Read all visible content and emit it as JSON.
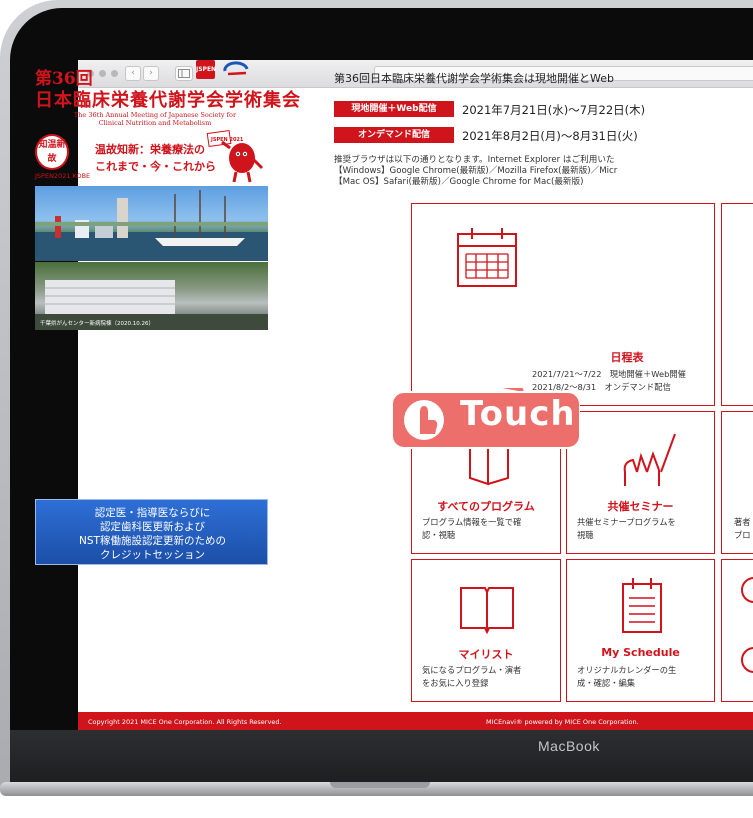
{
  "device": {
    "label": "MacBook"
  },
  "browser": {
    "back": "‹",
    "forward": "›"
  },
  "left": {
    "title_line1": "第36回",
    "title_line2": "日本臨床栄養代謝学会学術集会",
    "english_line1": "The 36th Annual Meeting of Japanese Society for",
    "english_line2": "Clinical Nutrition and Metabolism",
    "logo_badge": "JSPEN",
    "emblem_text": "知温新故",
    "emblem_sub": "JSPEN2021 KOBE",
    "theme_line1": "温故知新：栄養療法の",
    "theme_line2": "これまで・今・これから",
    "mascot_badge": "JSPEN 2021",
    "photo2_caption": "千葉県がんセンター新病院棟（2020.10.26）",
    "credit_lines": [
      "認定医・指導医ならびに",
      "認定歯科医更新および",
      "NST稼働施設認定更新のための",
      "クレジットセッション"
    ]
  },
  "right": {
    "headline": "第36回日本臨床栄養代謝学会学術集会は現地開催とWeb",
    "schedule": [
      {
        "tag": "現地開催＋Web配信",
        "date": "2021年7月21日(水)〜7月22日(木)"
      },
      {
        "tag": "オンデマンド配信",
        "date": "2021年8月2日(月)〜8月31日(火)"
      }
    ],
    "notes": [
      "推奨ブラウザは以下の通りとなります。Internet Explorer はご利用いた",
      "【Windows】Google Chrome(最新版)／Mozilla Firefox(最新版)／Micr",
      "【Mac OS】Safari(最新版)／Google Chrome for Mac(最新版)"
    ],
    "cards": {
      "schedule": {
        "title": "日程表",
        "desc1": "2021/7/21〜7/22　現地開催＋Web開催",
        "desc2": "2021/8/2〜8/31　オンデマンド配信"
      },
      "programs": {
        "title": "すべてのプログラム",
        "desc1": "プログラム情報を一覧で確",
        "desc2": "認・視聴"
      },
      "seminar": {
        "title": "共催セミナー",
        "desc1": "共催セミナープログラムを",
        "desc2": "視聴"
      },
      "partial": {
        "desc1": "著者",
        "desc2": "プロ"
      },
      "mylist": {
        "title": "マイリスト",
        "desc1": "気になるプログラム・演者",
        "desc2": "をお気に入り登録"
      },
      "myschedule": {
        "title": "My Schedule",
        "desc1": "オリジナルカレンダーの生",
        "desc2": "成・確認・編集"
      }
    },
    "touch": "Touch"
  },
  "footer": {
    "copyright": "Copyright 2021 MICE One Corporation. All Rights Reserved.",
    "powered": "MICEnavi® powered by MICE One Corporation."
  },
  "colors": {
    "accent": "#d0141c",
    "touch": "#ec6f6b",
    "banner": "#2e6fd6"
  }
}
